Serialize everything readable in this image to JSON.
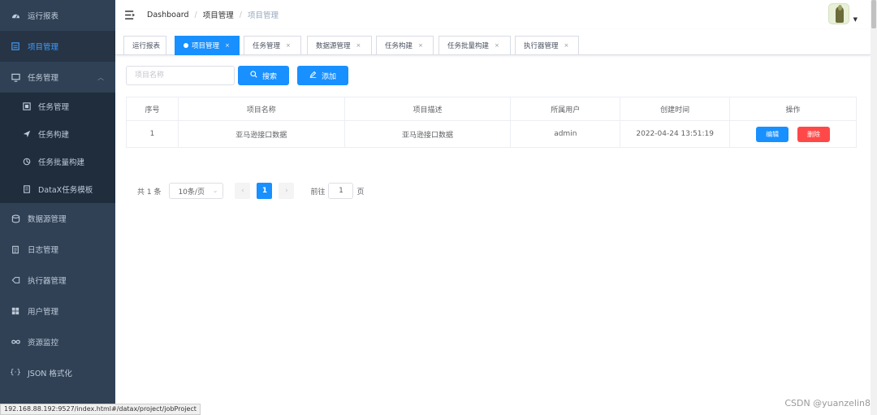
{
  "sidebar": {
    "items": [
      {
        "label": "运行报表",
        "icon": "dashboard-icon"
      },
      {
        "label": "项目管理",
        "icon": "project-icon"
      },
      {
        "label": "任务管理",
        "icon": "monitor-icon"
      }
    ],
    "sub_items": [
      {
        "label": "任务管理",
        "icon": "task-list-icon"
      },
      {
        "label": "任务构建",
        "icon": "send-icon"
      },
      {
        "label": "任务批量构建",
        "icon": "batch-icon"
      },
      {
        "label": "DataX任务模板",
        "icon": "template-icon"
      }
    ],
    "items_after": [
      {
        "label": "数据源管理",
        "icon": "database-icon"
      },
      {
        "label": "日志管理",
        "icon": "log-icon"
      },
      {
        "label": "执行器管理",
        "icon": "executor-icon"
      },
      {
        "label": "用户管理",
        "icon": "user-grid-icon"
      },
      {
        "label": "资源监控",
        "icon": "monitor-infinity-icon"
      },
      {
        "label": "JSON 格式化",
        "icon": "braces-icon"
      }
    ]
  },
  "header": {
    "breadcrumb": [
      "Dashboard",
      "项目管理",
      "项目管理"
    ]
  },
  "tags": [
    {
      "label": "运行报表"
    },
    {
      "label": "项目管理"
    },
    {
      "label": "任务管理"
    },
    {
      "label": "数据源管理"
    },
    {
      "label": "任务构建"
    },
    {
      "label": "任务批量构建"
    },
    {
      "label": "执行器管理"
    }
  ],
  "toolbar": {
    "search_placeholder": "项目名称",
    "search_label": "搜索",
    "add_label": "添加"
  },
  "table": {
    "columns": [
      "序号",
      "项目名称",
      "项目描述",
      "所属用户",
      "创建时间",
      "操作"
    ],
    "rows": [
      {
        "index": "1",
        "name": "亚马逊接口数据",
        "desc": "亚马逊接口数据",
        "user": "admin",
        "created": "2022-04-24 13:51:19",
        "edit": "编辑",
        "delete": "删除"
      }
    ]
  },
  "pagination": {
    "total_text": "共 1 条",
    "page_size": "10条/页",
    "current_page": "1",
    "goto_prefix": "前往",
    "goto_value": "1",
    "goto_suffix": "页"
  },
  "status_url": "192.168.88.192:9527/index.html#/datax/project/jobProject",
  "watermark": "CSDN @yuanzelin8",
  "colors": {
    "sidebar_bg": "#304156",
    "accent": "#1890ff",
    "danger": "#ff4949"
  }
}
